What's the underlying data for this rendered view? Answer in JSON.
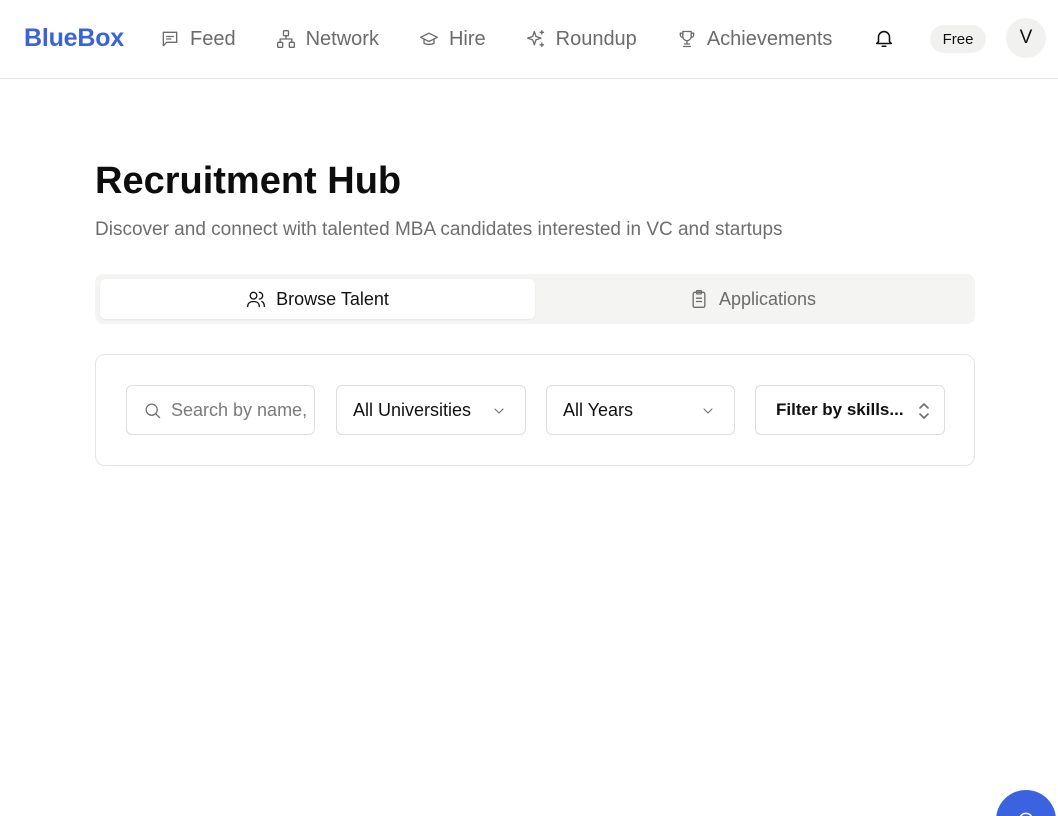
{
  "app": {
    "brand": "BlueBox"
  },
  "nav": {
    "items": [
      {
        "label": "Feed",
        "icon": "message-square-icon"
      },
      {
        "label": "Network",
        "icon": "network-icon"
      },
      {
        "label": "Hire",
        "icon": "graduation-cap-icon"
      },
      {
        "label": "Roundup",
        "icon": "sparkles-icon"
      },
      {
        "label": "Achievements",
        "icon": "trophy-icon"
      }
    ],
    "notifications_icon": "bell-icon",
    "plan_badge": "Free",
    "avatar_initial": "V"
  },
  "header": {
    "title": "Recruitment Hub",
    "subtitle": "Discover and connect with talented MBA candidates interested in VC and startups"
  },
  "tabs": [
    {
      "label": "Browse Talent",
      "icon": "users-icon",
      "active": true
    },
    {
      "label": "Applications",
      "icon": "clipboard-icon",
      "active": false
    }
  ],
  "filters": {
    "search_placeholder": "Search by name, school, or skill",
    "university": "All Universities",
    "year": "All Years",
    "skills": "Filter by skills..."
  },
  "colors": {
    "brand": "#3b63d8",
    "fab": "#3b63e0",
    "muted_text": "#6e6e6e",
    "tab_bg": "#f4f4f3"
  }
}
